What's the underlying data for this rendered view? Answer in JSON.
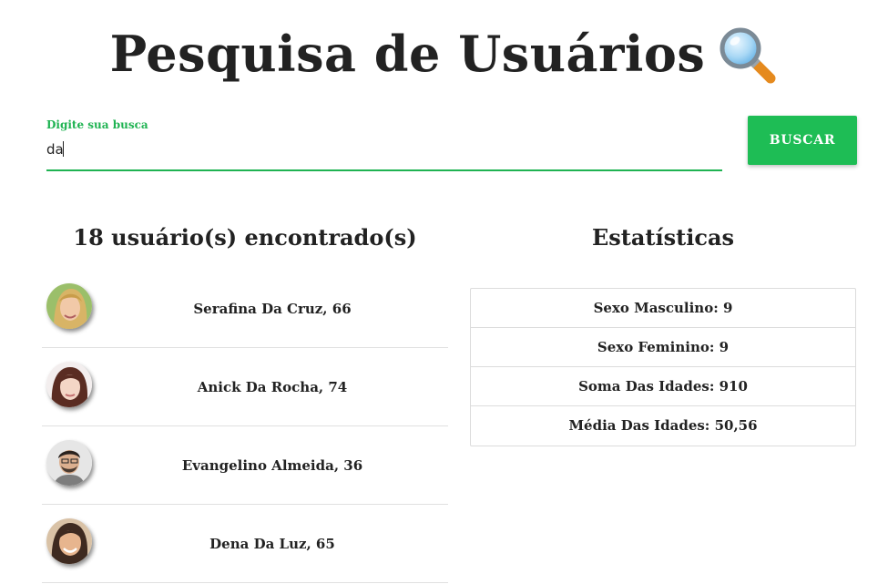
{
  "header": {
    "title": "Pesquisa de Usuários",
    "title_icon": "magnifying-glass-icon"
  },
  "search": {
    "label": "Digite sua busca",
    "value": "da",
    "button_label": "BUSCAR"
  },
  "colors": {
    "accent": "#1ebd55",
    "label_green": "#1fb352",
    "text": "#222222",
    "divider": "#e0e0e0"
  },
  "users_section": {
    "title": "18 usuário(s) encontrado(s)",
    "users": [
      {
        "name": "Serafina Da Cruz, 66",
        "avatar": "avatar-photo-blonde-woman"
      },
      {
        "name": "Anick Da Rocha, 74",
        "avatar": "avatar-photo-dark-haired-woman"
      },
      {
        "name": "Evangelino Almeida, 36",
        "avatar": "avatar-photo-man-with-beard"
      },
      {
        "name": "Dena Da Luz, 65",
        "avatar": "avatar-photo-smiling-woman"
      }
    ]
  },
  "stats_section": {
    "title": "Estatísticas",
    "rows": [
      {
        "text": "Sexo Masculino: 9"
      },
      {
        "text": "Sexo Feminino: 9"
      },
      {
        "text": "Soma Das Idades: 910"
      },
      {
        "text": "Média Das Idades: 50,56"
      }
    ]
  }
}
